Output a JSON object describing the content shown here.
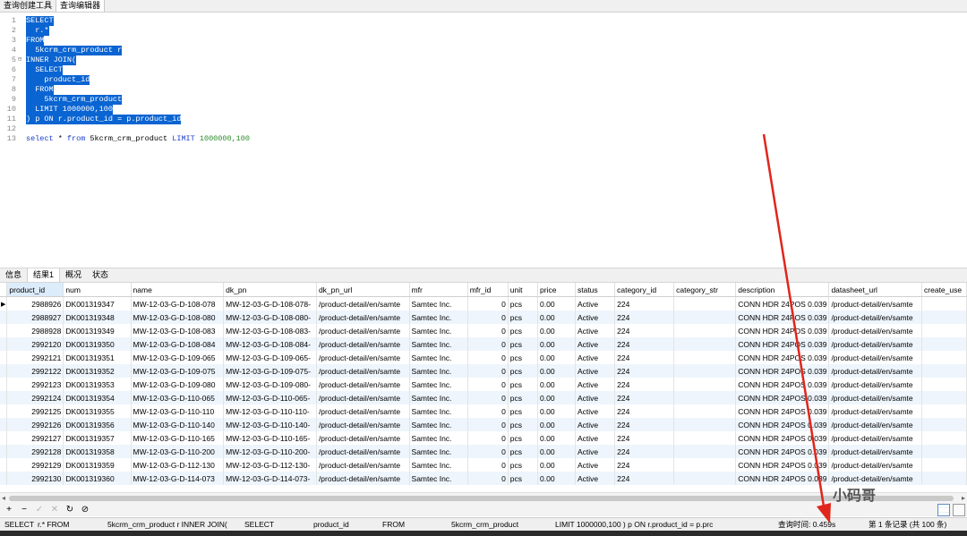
{
  "tabs": [
    "查询创建工具",
    "查询编辑器"
  ],
  "editor": {
    "lines": [
      {
        "n": "1",
        "text": "SELECT",
        "selected": true
      },
      {
        "n": "2",
        "text": "  r.*",
        "selected": true
      },
      {
        "n": "3",
        "text": "FROM",
        "selected": true
      },
      {
        "n": "4",
        "text": "  5kcrm_crm_product r",
        "selected": true
      },
      {
        "n": "5",
        "text": "INNER JOIN(",
        "selected": true,
        "fold": true
      },
      {
        "n": "6",
        "text": "  SELECT",
        "selected": true
      },
      {
        "n": "7",
        "text": "    product_id",
        "selected": true
      },
      {
        "n": "8",
        "text": "  FROM",
        "selected": true
      },
      {
        "n": "9",
        "text": "    5kcrm_crm_product",
        "selected": true
      },
      {
        "n": "10",
        "text": "  LIMIT 1000000,100",
        "selected": true
      },
      {
        "n": "11",
        "text": ") p ON r.product_id = p.product_id",
        "selected": true
      },
      {
        "n": "12",
        "text": "",
        "selected": false
      },
      {
        "n": "13",
        "text": "",
        "selected": false
      }
    ],
    "line13": {
      "kw1": "select",
      "mid": " * ",
      "kw2": "from",
      "table": " 5kcrm_crm_product ",
      "kw3": "LIMIT",
      "nums": " 1000000,100"
    }
  },
  "result_tabs": [
    "信息",
    "结果1",
    "概况",
    "状态"
  ],
  "grid": {
    "columns": [
      "product_id",
      "num",
      "name",
      "dk_pn",
      "dk_pn_url",
      "mfr",
      "mfr_id",
      "unit",
      "price",
      "status",
      "category_id",
      "category_str",
      "description",
      "datasheet_url",
      "create_use"
    ],
    "rows": [
      [
        "2988926",
        "DK001319347",
        "MW-12-03-G-D-108-078",
        "MW-12-03-G-D-108-078-",
        "/product-detail/en/samte",
        "Samtec Inc.",
        "0",
        "pcs",
        "0.00",
        "Active",
        "224",
        "",
        "CONN HDR 24POS 0.039",
        "/product-detail/en/samte",
        ""
      ],
      [
        "2988927",
        "DK001319348",
        "MW-12-03-G-D-108-080",
        "MW-12-03-G-D-108-080-",
        "/product-detail/en/samte",
        "Samtec Inc.",
        "0",
        "pcs",
        "0.00",
        "Active",
        "224",
        "",
        "CONN HDR 24POS 0.039",
        "/product-detail/en/samte",
        ""
      ],
      [
        "2988928",
        "DK001319349",
        "MW-12-03-G-D-108-083",
        "MW-12-03-G-D-108-083-",
        "/product-detail/en/samte",
        "Samtec Inc.",
        "0",
        "pcs",
        "0.00",
        "Active",
        "224",
        "",
        "CONN HDR 24POS 0.039",
        "/product-detail/en/samte",
        ""
      ],
      [
        "2992120",
        "DK001319350",
        "MW-12-03-G-D-108-084",
        "MW-12-03-G-D-108-084-",
        "/product-detail/en/samte",
        "Samtec Inc.",
        "0",
        "pcs",
        "0.00",
        "Active",
        "224",
        "",
        "CONN HDR 24POS 0.039",
        "/product-detail/en/samte",
        ""
      ],
      [
        "2992121",
        "DK001319351",
        "MW-12-03-G-D-109-065",
        "MW-12-03-G-D-109-065-",
        "/product-detail/en/samte",
        "Samtec Inc.",
        "0",
        "pcs",
        "0.00",
        "Active",
        "224",
        "",
        "CONN HDR 24POS 0.039",
        "/product-detail/en/samte",
        ""
      ],
      [
        "2992122",
        "DK001319352",
        "MW-12-03-G-D-109-075",
        "MW-12-03-G-D-109-075-",
        "/product-detail/en/samte",
        "Samtec Inc.",
        "0",
        "pcs",
        "0.00",
        "Active",
        "224",
        "",
        "CONN HDR 24POS 0.039",
        "/product-detail/en/samte",
        ""
      ],
      [
        "2992123",
        "DK001319353",
        "MW-12-03-G-D-109-080",
        "MW-12-03-G-D-109-080-",
        "/product-detail/en/samte",
        "Samtec Inc.",
        "0",
        "pcs",
        "0.00",
        "Active",
        "224",
        "",
        "CONN HDR 24POS 0.039",
        "/product-detail/en/samte",
        ""
      ],
      [
        "2992124",
        "DK001319354",
        "MW-12-03-G-D-110-065",
        "MW-12-03-G-D-110-065-",
        "/product-detail/en/samte",
        "Samtec Inc.",
        "0",
        "pcs",
        "0.00",
        "Active",
        "224",
        "",
        "CONN HDR 24POS 0.039",
        "/product-detail/en/samte",
        ""
      ],
      [
        "2992125",
        "DK001319355",
        "MW-12-03-G-D-110-110",
        "MW-12-03-G-D-110-110-",
        "/product-detail/en/samte",
        "Samtec Inc.",
        "0",
        "pcs",
        "0.00",
        "Active",
        "224",
        "",
        "CONN HDR 24POS 0.039",
        "/product-detail/en/samte",
        ""
      ],
      [
        "2992126",
        "DK001319356",
        "MW-12-03-G-D-110-140",
        "MW-12-03-G-D-110-140-",
        "/product-detail/en/samte",
        "Samtec Inc.",
        "0",
        "pcs",
        "0.00",
        "Active",
        "224",
        "",
        "CONN HDR 24POS 0.039",
        "/product-detail/en/samte",
        ""
      ],
      [
        "2992127",
        "DK001319357",
        "MW-12-03-G-D-110-165",
        "MW-12-03-G-D-110-165-",
        "/product-detail/en/samte",
        "Samtec Inc.",
        "0",
        "pcs",
        "0.00",
        "Active",
        "224",
        "",
        "CONN HDR 24POS 0.039",
        "/product-detail/en/samte",
        ""
      ],
      [
        "2992128",
        "DK001319358",
        "MW-12-03-G-D-110-200",
        "MW-12-03-G-D-110-200-",
        "/product-detail/en/samte",
        "Samtec Inc.",
        "0",
        "pcs",
        "0.00",
        "Active",
        "224",
        "",
        "CONN HDR 24POS 0.039",
        "/product-detail/en/samte",
        ""
      ],
      [
        "2992129",
        "DK001319359",
        "MW-12-03-G-D-112-130",
        "MW-12-03-G-D-112-130-",
        "/product-detail/en/samte",
        "Samtec Inc.",
        "0",
        "pcs",
        "0.00",
        "Active",
        "224",
        "",
        "CONN HDR 24POS 0.039",
        "/product-detail/en/samte",
        ""
      ],
      [
        "2992130",
        "DK001319360",
        "MW-12-03-G-D-114-073",
        "MW-12-03-G-D-114-073-",
        "/product-detail/en/samte",
        "Samtec Inc.",
        "0",
        "pcs",
        "0.00",
        "Active",
        "224",
        "",
        "CONN HDR 24POS 0.039",
        "/product-detail/en/samte",
        ""
      ]
    ]
  },
  "toolbar": {
    "icons": [
      "plus-icon",
      "minus-icon",
      "check-icon",
      "cross-icon",
      "refresh-icon",
      "stop-icon"
    ],
    "glyphs": [
      "+",
      "−",
      "✓",
      "✕",
      "↻",
      "⊘"
    ]
  },
  "watermark": "小码哥",
  "status": {
    "parts": [
      "SELECT",
      "r.* FROM",
      "5kcrm_crm_product r INNER JOIN(",
      "SELECT",
      "product_id",
      "FROM",
      "5kcrm_crm_product",
      "LIMIT 1000000,100 ) p ON r.product_id = p.prc"
    ],
    "query_time": "查询时间: 0.459s",
    "record": "第 1 条记录 (共 100 条)"
  },
  "colors": {
    "selection": "#0a64d2",
    "keyword": "#1c3fc6",
    "number": "#2a8a2a",
    "annotation_arrow": "#e0261b"
  }
}
